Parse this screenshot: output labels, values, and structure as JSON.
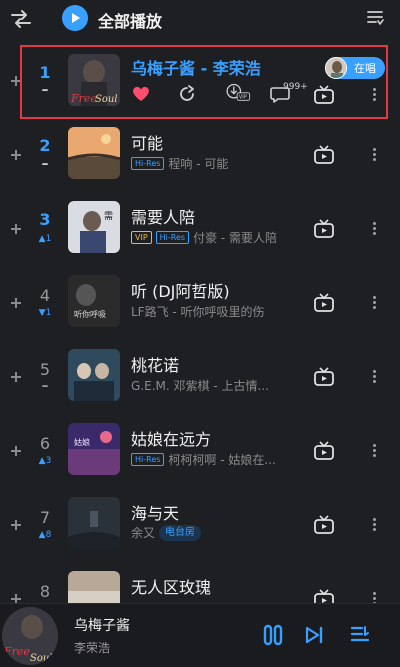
{
  "topbar": {
    "play_all_label": "全部播放"
  },
  "current": {
    "title": "乌梅子酱 - 李荣浩",
    "now_playing_label": "在唱",
    "comment_count": "999+",
    "cover_text": "Free Soul"
  },
  "songs": [
    {
      "rank": "1",
      "trend": "–",
      "title": "乌梅子酱 - 李荣浩",
      "tags": [],
      "meta": ""
    },
    {
      "rank": "2",
      "trend": "–",
      "title": "可能",
      "tags": [
        "Hi-Res"
      ],
      "meta": "程响 - 可能"
    },
    {
      "rank": "3",
      "trend": "▲1",
      "title": "需要人陪",
      "tags": [
        "VIP",
        "Hi-Res"
      ],
      "meta": "付豪 - 需要人陪"
    },
    {
      "rank": "4",
      "trend": "▼1",
      "title": "听 (DJ阿哲版)",
      "tags": [],
      "meta": "LF路飞 - 听你呼吸里的伤"
    },
    {
      "rank": "5",
      "trend": "–",
      "title": "桃花诺",
      "tags": [],
      "meta": "G.E.M. 邓紫棋 - 上古情..."
    },
    {
      "rank": "6",
      "trend": "▲3",
      "title": "姑娘在远方",
      "tags": [
        "Hi-Res"
      ],
      "meta": "柯柯柯啊 - 姑娘在..."
    },
    {
      "rank": "7",
      "trend": "▲8",
      "title": "海与天",
      "tags": [],
      "meta": "余又",
      "radio_tag": "电台房"
    },
    {
      "rank": "8",
      "trend": "",
      "title": "无人区玫瑰",
      "tags": [],
      "meta": ""
    }
  ],
  "player": {
    "title": "乌梅子酱",
    "artist": "李荣浩"
  },
  "colors": {
    "accent": "#3aa0ff",
    "highlight_border": "#e23a44",
    "heart": "#ff4d6d",
    "background": "#1e1f22"
  },
  "icons": [
    "shuffle-icon",
    "play-icon",
    "manage-list-icon",
    "heart-icon",
    "share-icon",
    "download-vip-icon",
    "comment-icon",
    "video-icon",
    "more-icon",
    "pause-icon",
    "next-icon",
    "queue-icon"
  ]
}
